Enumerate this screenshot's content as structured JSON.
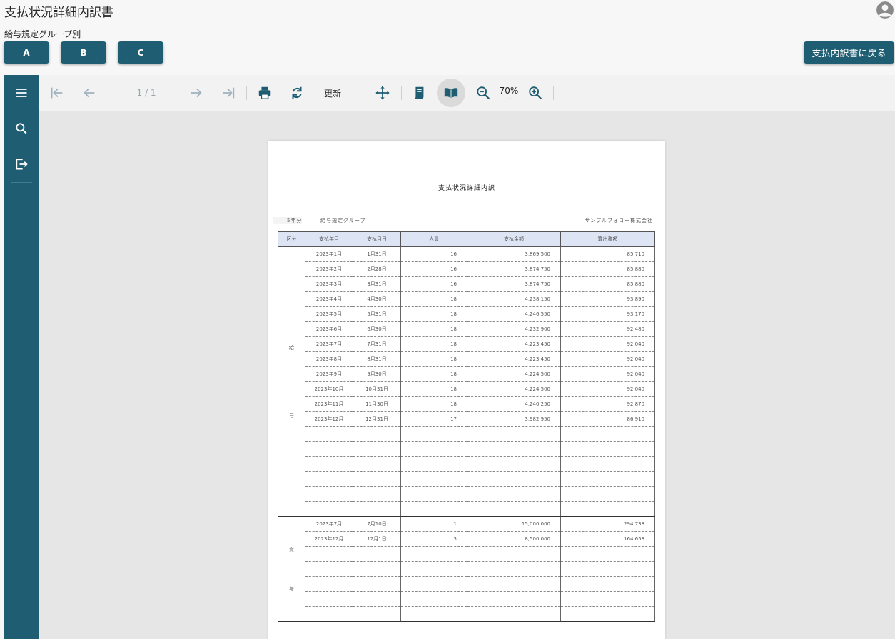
{
  "app": {
    "title": "支払状況詳細内訳書",
    "group_label": "給与規定グループ別",
    "group_buttons": [
      "A",
      "B",
      "C"
    ],
    "back_button": "支払内訳書に戻る"
  },
  "toolbar": {
    "page_indicator": "1 / 1",
    "refresh_label": "更新",
    "zoom": "70%",
    "zoom_more": "..."
  },
  "icons": {
    "avatar": "account-circle-icon",
    "menu": "menu-icon",
    "search": "search-icon",
    "export": "export-icon",
    "first": "first-page-icon",
    "prev": "prev-page-icon",
    "next": "next-page-icon",
    "last": "last-page-icon",
    "print": "print-icon",
    "refresh": "refresh-icon",
    "pan": "pan-icon",
    "continuous": "continuous-page-icon",
    "book": "book-view-icon",
    "zoom_out": "zoom-out-icon",
    "zoom_in": "zoom-in-icon"
  },
  "colors": {
    "accent": "#1f5e72",
    "header_cell": "#dde4f4"
  },
  "report": {
    "title": "支払状況詳細内訳",
    "year_suffix": "5年分",
    "group_text": "給与規定グループ",
    "company": "サンプルフォロー株式会社",
    "headers": [
      "区分",
      "支払年月",
      "支払月日",
      "人員",
      "支払金額",
      "算出税額"
    ],
    "sections": [
      {
        "label_top": "給",
        "label_bottom": "与",
        "rows": [
          [
            "2023年1月",
            "1月31日",
            "16",
            "3,869,500",
            "85,710"
          ],
          [
            "2023年2月",
            "2月28日",
            "16",
            "3,874,750",
            "85,880"
          ],
          [
            "2023年3月",
            "3月31日",
            "16",
            "3,874,750",
            "85,880"
          ],
          [
            "2023年4月",
            "4月30日",
            "18",
            "4,238,150",
            "93,890"
          ],
          [
            "2023年5月",
            "5月31日",
            "18",
            "4,246,550",
            "93,170"
          ],
          [
            "2023年6月",
            "6月30日",
            "18",
            "4,232,900",
            "92,480"
          ],
          [
            "2023年7月",
            "7月31日",
            "18",
            "4,223,450",
            "92,040"
          ],
          [
            "2023年8月",
            "8月31日",
            "18",
            "4,223,450",
            "92,040"
          ],
          [
            "2023年9月",
            "9月30日",
            "18",
            "4,224,500",
            "92,040"
          ],
          [
            "2023年10月",
            "10月31日",
            "18",
            "4,224,500",
            "92,040"
          ],
          [
            "2023年11月",
            "11月30日",
            "18",
            "4,240,250",
            "92,870"
          ],
          [
            "2023年12月",
            "12月31日",
            "17",
            "3,982,950",
            "86,910"
          ],
          [
            "",
            "",
            "",
            "",
            ""
          ],
          [
            "",
            "",
            "",
            "",
            ""
          ],
          [
            "",
            "",
            "",
            "",
            ""
          ],
          [
            "",
            "",
            "",
            "",
            ""
          ],
          [
            "",
            "",
            "",
            "",
            ""
          ],
          [
            "",
            "",
            "",
            "",
            ""
          ]
        ]
      },
      {
        "label_top": "賞",
        "label_bottom": "与",
        "rows": [
          [
            "2023年7月",
            "7月10日",
            "1",
            "15,000,000",
            "294,738"
          ],
          [
            "2023年12月",
            "12月1日",
            "3",
            "8,500,000",
            "164,658"
          ],
          [
            "",
            "",
            "",
            "",
            ""
          ],
          [
            "",
            "",
            "",
            "",
            ""
          ],
          [
            "",
            "",
            "",
            "",
            ""
          ],
          [
            "",
            "",
            "",
            "",
            ""
          ],
          [
            "",
            "",
            "",
            "",
            ""
          ]
        ]
      }
    ]
  }
}
